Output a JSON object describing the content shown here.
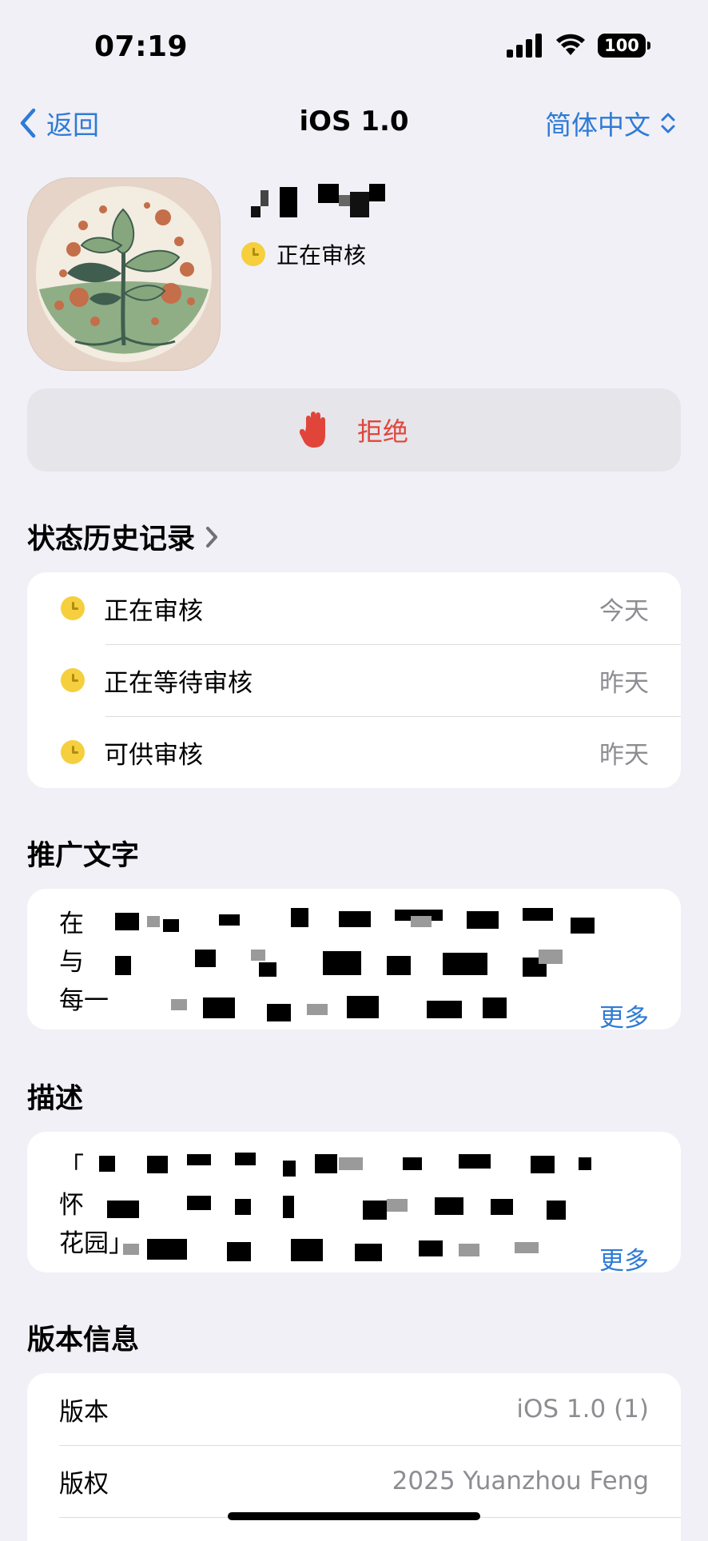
{
  "status_bar": {
    "time": "07:19",
    "battery": "100"
  },
  "nav": {
    "back_label": "返回",
    "title": "iOS 1.0",
    "language": "简体中文"
  },
  "app": {
    "review_status": "正在审核"
  },
  "reject_button": {
    "label": "拒绝"
  },
  "history": {
    "title": "状态历史记录",
    "items": [
      {
        "label": "正在审核",
        "date": "今天"
      },
      {
        "label": "正在等待审核",
        "date": "昨天"
      },
      {
        "label": "可供审核",
        "date": "昨天"
      }
    ]
  },
  "promo": {
    "title": "推广文字",
    "line_starts": [
      "在",
      "与",
      "每一"
    ],
    "more": "更多"
  },
  "description": {
    "title": "描述",
    "line_starts": [
      "「",
      "怀",
      "花园」"
    ],
    "more": "更多"
  },
  "version_info": {
    "title": "版本信息",
    "rows": [
      {
        "label": "版本",
        "value": "iOS 1.0 (1)"
      },
      {
        "label": "版权",
        "value": "2025 Yuanzhou Feng"
      }
    ]
  },
  "colors": {
    "accent": "#2f7bd6",
    "reject": "#e1453a",
    "pending": "#f5cf3d",
    "background": "#f1f0f6"
  },
  "icons": [
    "chevron-left-icon",
    "chevron-updown-icon",
    "hand-stop-icon",
    "chevron-right-icon",
    "clock-dot-icon"
  ]
}
